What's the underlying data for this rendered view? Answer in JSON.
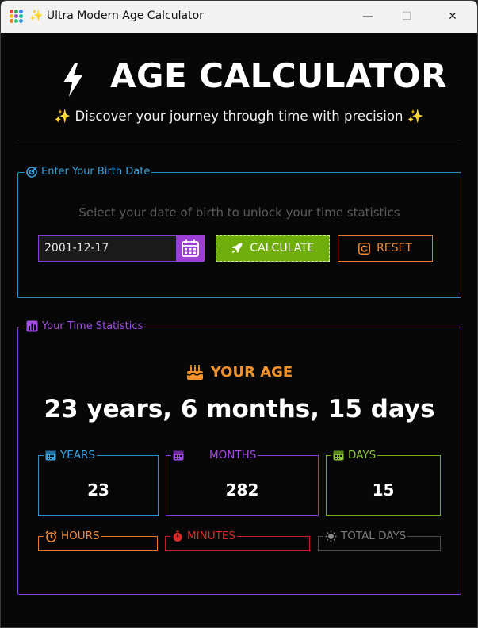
{
  "window": {
    "title": "Ultra Modern Age Calculator",
    "title_icon": "sparkles-emoji",
    "minimize_glyph": "—",
    "maximize_glyph": "☐",
    "close_glyph": "✕"
  },
  "header": {
    "title": "AGE CALCULATOR",
    "subtitle": "Discover your journey through time with precision",
    "sparkle": "✨"
  },
  "birth_section": {
    "legend": "Enter Your Birth Date",
    "prompt": "Select your date of birth to unlock your time statistics",
    "date_value": "2001-12-17",
    "calculate_label": "CALCULATE",
    "reset_label": "RESET"
  },
  "stats_section": {
    "legend": "Your Time Statistics",
    "age_heading": "YOUR AGE",
    "age_value": "23 years, 6 months, 15 days",
    "cards": {
      "years": {
        "label": "YEARS",
        "value": "23"
      },
      "months": {
        "label": "MONTHS",
        "value": "282"
      },
      "days": {
        "label": "DAYS",
        "value": "15"
      },
      "hours": {
        "label": "HOURS"
      },
      "minutes": {
        "label": "MINUTES"
      },
      "total_days": {
        "label": "TOTAL DAYS"
      }
    }
  },
  "colors": {
    "background": "#070707",
    "blue": "#2f8fc8",
    "purple": "#8a3bd4",
    "green": "#6fae0c",
    "orange": "#e07a2a",
    "red": "#c81e1e",
    "grey": "#4a4a4a"
  }
}
